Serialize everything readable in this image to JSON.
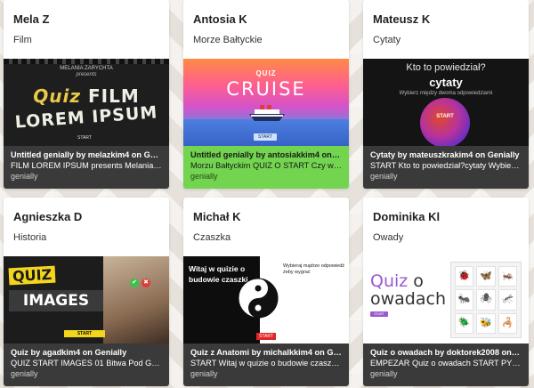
{
  "cards": [
    {
      "author": "Mela Z",
      "topic": "Film",
      "title": "Untitled genially by melazkim4 on Genially",
      "desc": "FILM LOREM IPSUM presents Melania Z...",
      "platform": "genially",
      "thumb": {
        "line1": "MELANIA ZARYCHTA",
        "line2": "presents",
        "big1_q": "Quiz",
        "big1_rest": " FILM",
        "big2": "LOREM IPSUM",
        "start": "START"
      }
    },
    {
      "author": "Antosia K",
      "topic": "Morze Bałtyckie",
      "title": "Untitled genially by antosiakkim4 on Ge...",
      "desc": "Morzu Bałtyckim QUIZ O START Czy w M...",
      "platform": "genially",
      "thumb": {
        "quiz": "QUIZ",
        "cruise": "CRUISE",
        "start": "START"
      }
    },
    {
      "author": "Mateusz K",
      "topic": "Cytaty",
      "title": "Cytaty by mateuszkrakim4 on Genially",
      "desc": "START Kto to powiedział?cytaty Wybierz...",
      "platform": "genially",
      "thumb": {
        "line1": "Kto to powiedział?",
        "line2": "cytaty",
        "line3": "Wybierz między dwoma odpowiedziami",
        "start": "START"
      }
    },
    {
      "author": "Agnieszka D",
      "topic": "Historia",
      "title": "Quiz by agadkim4 on Genially",
      "desc": "QUIZ START IMAGES 01 Bitwa Pod Grun...",
      "platform": "genially",
      "thumb": {
        "quiz": "QUIZ",
        "images": "IMAGES",
        "check": "✔",
        "cross": "✖",
        "start": "START"
      }
    },
    {
      "author": "Michał K",
      "topic": "Czaszka",
      "title": "Quiz z Anatomi by michalkkim4 on Geni...",
      "desc": "START Witaj w quizie o budowie czaszki ...",
      "platform": "genially",
      "thumb": {
        "welcome": "Witaj w quizie o budowie czaszki",
        "note": "Wybierај mądrze odpowiedź żeby wygrać",
        "start": "START"
      }
    },
    {
      "author": "Dominika Kl",
      "topic": "Owady",
      "title": "Quiz o owadach by doktorek2008 on Ge...",
      "desc": "EMPEZAR Quiz o owadach START PYTA...",
      "platform": "genially",
      "thumb": {
        "quiz": "Quiz",
        "rest1": " o",
        "rest2": "owadach",
        "start": "START",
        "insects": [
          "🐞",
          "🦋",
          "🦗",
          "🐜",
          "🕷",
          "🦟",
          "🪲",
          "🐝",
          "🦂"
        ]
      }
    }
  ],
  "colors": {
    "info_dark": "#3a3a3a",
    "info_green": "#72d44f"
  }
}
